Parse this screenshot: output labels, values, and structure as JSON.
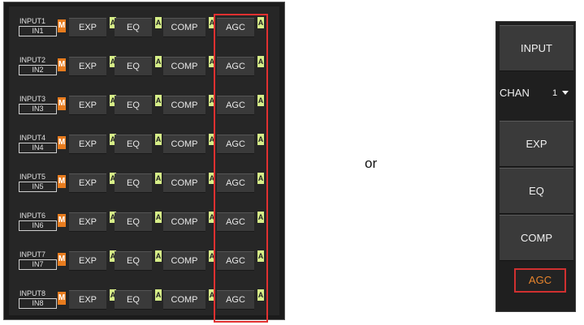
{
  "matrix": {
    "rows": [
      {
        "input_name": "INPUT1",
        "channel": "IN1"
      },
      {
        "input_name": "INPUT2",
        "channel": "IN2"
      },
      {
        "input_name": "INPUT3",
        "channel": "IN3"
      },
      {
        "input_name": "INPUT4",
        "channel": "IN4"
      },
      {
        "input_name": "INPUT5",
        "channel": "IN5"
      },
      {
        "input_name": "INPUT6",
        "channel": "IN6"
      },
      {
        "input_name": "INPUT7",
        "channel": "IN7"
      },
      {
        "input_name": "INPUT8",
        "channel": "IN8"
      }
    ],
    "mute_label": "M",
    "active_label": "A",
    "modules": [
      "EXP",
      "EQ",
      "COMP",
      "AGC"
    ]
  },
  "separator_text": "or",
  "channel_panel": {
    "input_label": "INPUT",
    "chan_label": "CHAN",
    "chan_value": "1",
    "buttons": [
      "EXP",
      "EQ",
      "COMP"
    ],
    "selected_label": "AGC"
  },
  "colors": {
    "mute": "#e87c1e",
    "active_indicator": "#d7ef88",
    "highlight": "#e03030",
    "selected_text": "#e8852c"
  }
}
